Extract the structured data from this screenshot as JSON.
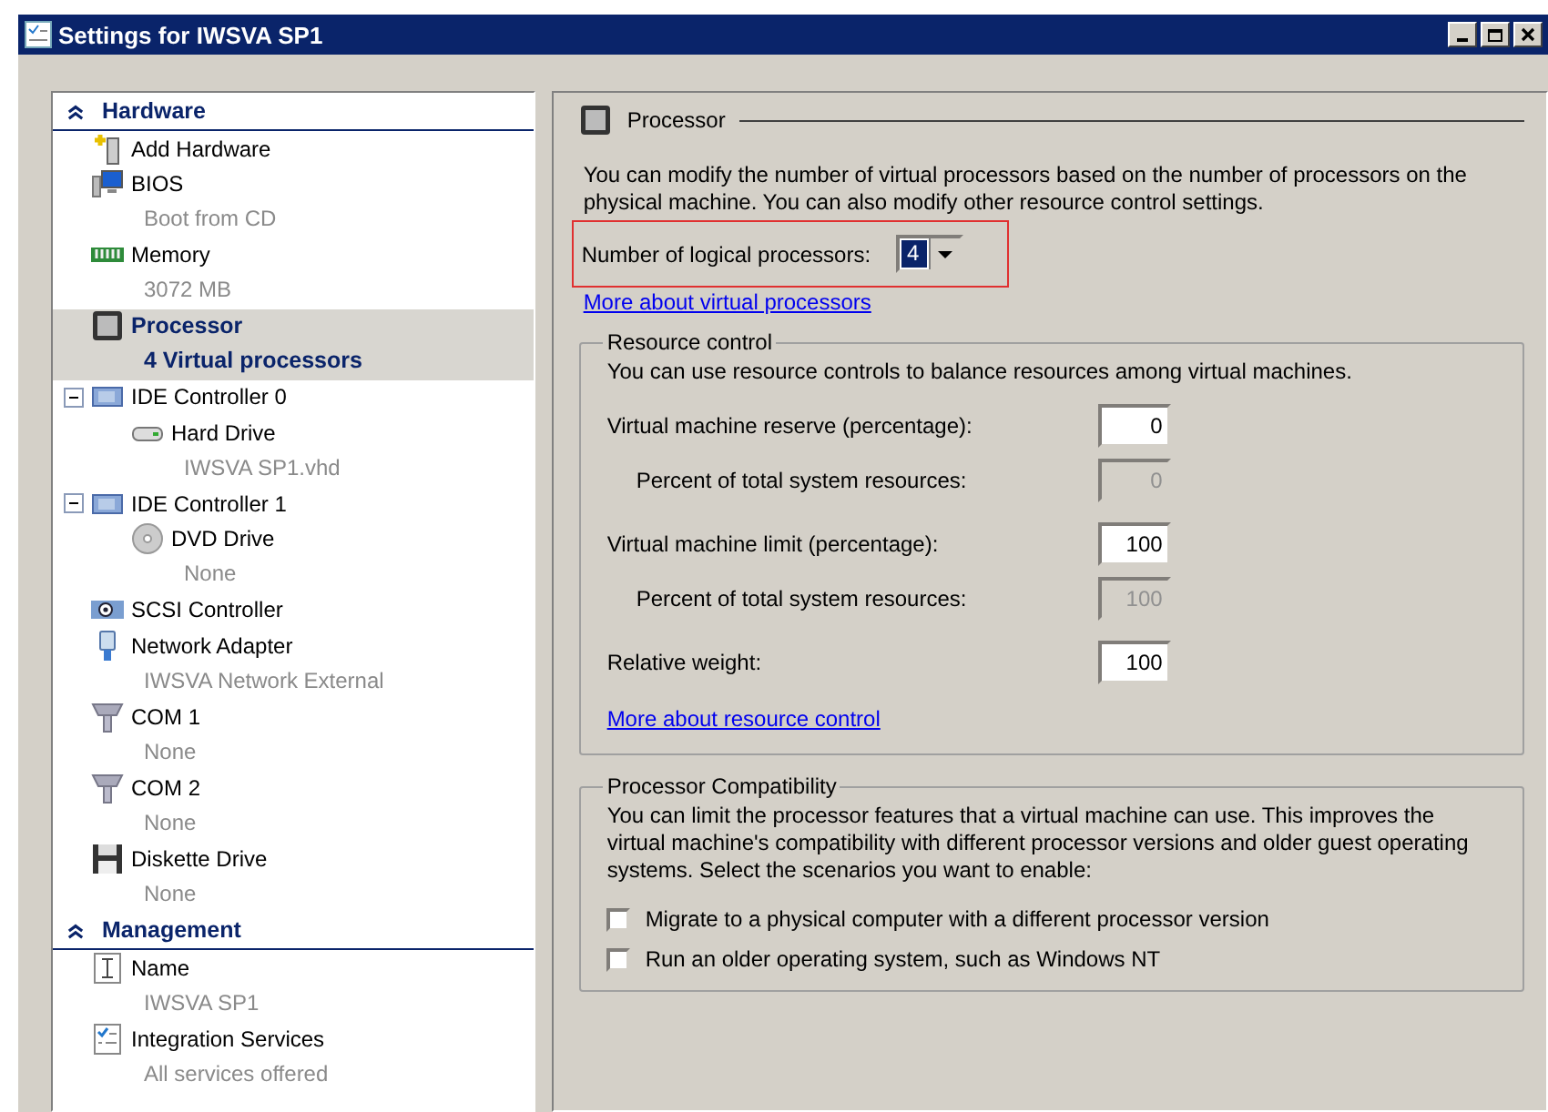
{
  "window": {
    "title": "Settings for IWSVA SP1"
  },
  "sidebar": {
    "sections": [
      {
        "title": "Hardware",
        "expanded": true,
        "items": [
          {
            "kind": "add-hardware",
            "label": "Add Hardware",
            "selected": false
          },
          {
            "kind": "bios",
            "label": "BIOS",
            "detail": "Boot from CD",
            "selected": false
          },
          {
            "kind": "memory",
            "label": "Memory",
            "detail": "3072 MB",
            "selected": false
          },
          {
            "kind": "processor",
            "label": "Processor",
            "detail": "4 Virtual processors",
            "selected": true
          },
          {
            "kind": "controller",
            "label": "IDE Controller 0",
            "selected": false,
            "expanded": true,
            "children": [
              {
                "kind": "hard-drive",
                "label": "Hard Drive",
                "detail": "IWSVA SP1.vhd",
                "selected": false
              }
            ]
          },
          {
            "kind": "controller",
            "label": "IDE Controller 1",
            "selected": false,
            "expanded": true,
            "children": [
              {
                "kind": "dvd",
                "label": "DVD Drive",
                "detail": "None",
                "selected": false
              }
            ]
          },
          {
            "kind": "scsi",
            "label": "SCSI Controller",
            "selected": false
          },
          {
            "kind": "network",
            "label": "Network Adapter",
            "detail": "IWSVA Network External",
            "selected": false
          },
          {
            "kind": "com",
            "label": "COM 1",
            "detail": "None",
            "selected": false
          },
          {
            "kind": "com",
            "label": "COM 2",
            "detail": "None",
            "selected": false
          },
          {
            "kind": "diskette",
            "label": "Diskette Drive",
            "detail": "None",
            "selected": false
          }
        ]
      },
      {
        "title": "Management",
        "expanded": true,
        "items": [
          {
            "kind": "name",
            "label": "Name",
            "detail": "IWSVA SP1",
            "selected": false
          },
          {
            "kind": "integration",
            "label": "Integration Services",
            "detail": "All services offered",
            "selected": false
          }
        ]
      }
    ]
  },
  "panel": {
    "title": "Processor",
    "description": "You can modify the number of virtual processors based on the number of processors on the physical machine. You can also modify other resource control settings.",
    "processors": {
      "label": "Number of logical processors:",
      "value": "4",
      "highlighted": true
    },
    "link": "More about virtual processors",
    "resource_control": {
      "title": "Resource control",
      "description": "You can use resource controls to balance resources among virtual machines.",
      "fields": [
        {
          "label": "Virtual machine reserve (percentage):",
          "value": "0",
          "disabled": false,
          "indented": false
        },
        {
          "label": "Percent of total system resources:",
          "value": "0",
          "disabled": true,
          "indented": true
        },
        {
          "label": "Virtual machine limit (percentage):",
          "value": "100",
          "disabled": false,
          "indented": false
        },
        {
          "label": "Percent of total system resources:",
          "value": "100",
          "disabled": true,
          "indented": true
        },
        {
          "label": "Relative weight:",
          "value": "100",
          "disabled": false,
          "indented": false
        }
      ],
      "link": "More about resource control"
    },
    "compatibility": {
      "title": "Processor Compatibility",
      "description": "You can limit the processor features that a virtual machine can use. This improves the virtual machine's compatibility with different processor versions and older guest operating systems. Select the scenarios you want to enable:",
      "options": [
        {
          "label": "Migrate to a physical computer with a different processor version",
          "checked": false
        },
        {
          "label": "Run an older operating system, such as Windows NT",
          "checked": false
        }
      ]
    }
  }
}
